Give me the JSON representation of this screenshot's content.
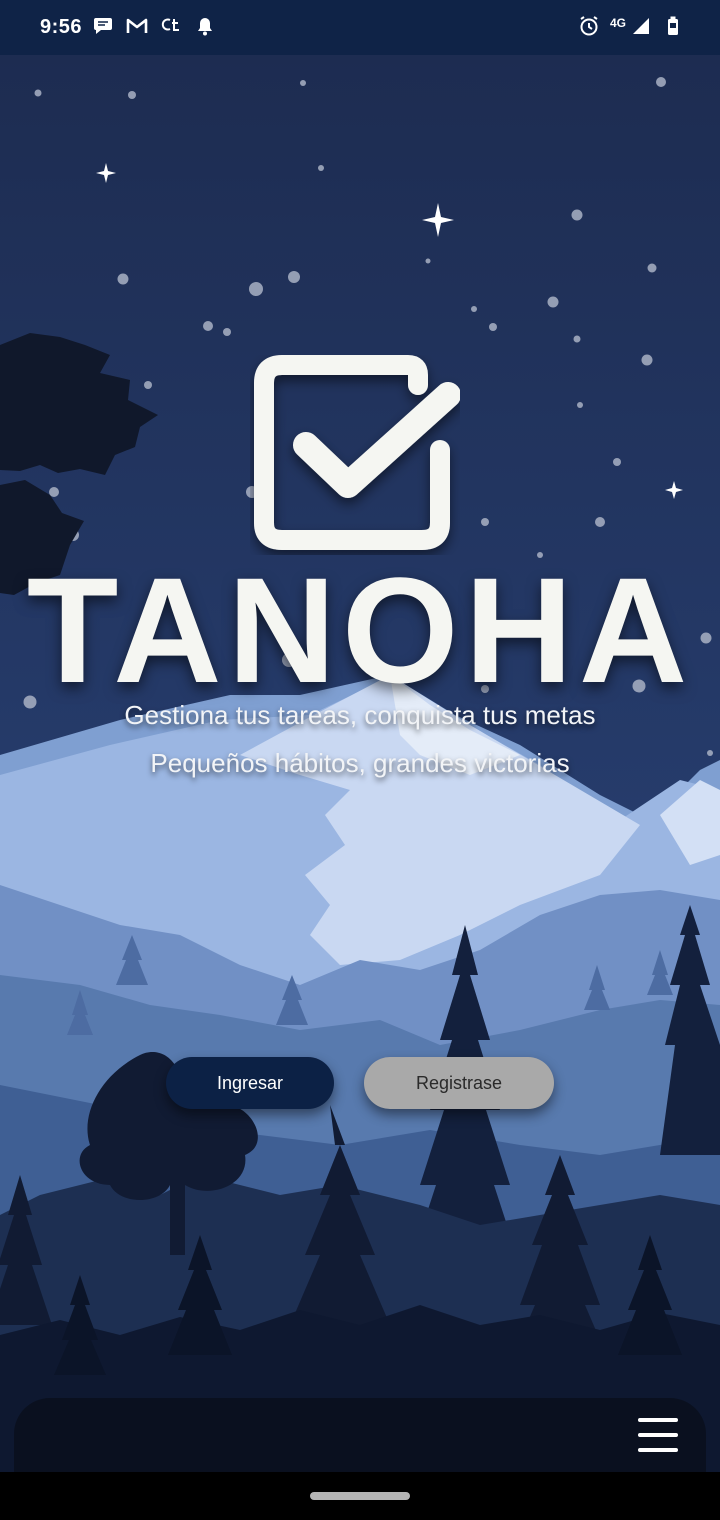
{
  "status_bar": {
    "time": "9:56",
    "network": "4G",
    "left_icons": [
      "chat-icon",
      "gmail-icon",
      "ct-icon",
      "bell-icon"
    ],
    "right_icons": [
      "alarm-icon",
      "signal-icon",
      "battery-icon"
    ]
  },
  "app": {
    "brand": "TANOHA",
    "tagline_1": "Gestiona tus tareas, conquista tus metas",
    "tagline_2": "Pequeños hábitos, grandes victorias"
  },
  "buttons": {
    "login_label": "Ingresar",
    "register_label": "Registrase"
  },
  "bottom_bar": {
    "menu_icon": "hamburger-menu-icon"
  },
  "colors": {
    "status_bar": "#0f2347",
    "sky": "#1f3158",
    "login_button": "#0c2145",
    "register_button": "#a9a9a9",
    "text": "#f5f6f2"
  }
}
